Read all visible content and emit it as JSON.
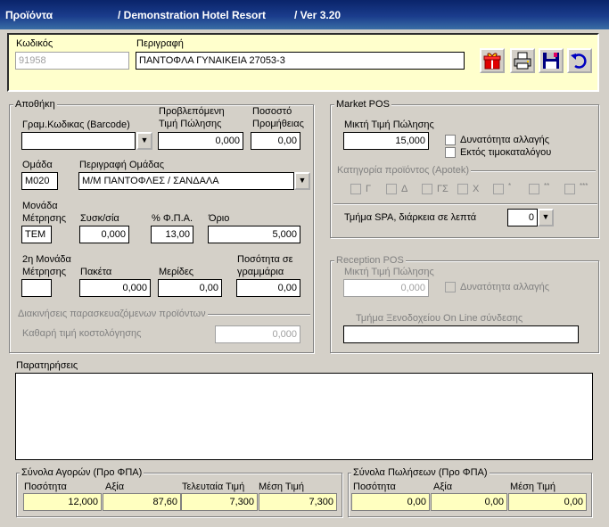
{
  "title": {
    "app": "Προϊόντα",
    "hotel": "/ Demonstration Hotel Resort",
    "version": "/  Ver  3.20"
  },
  "header": {
    "code_label": "Κωδικός",
    "code_value": "91958",
    "desc_label": "Περιγραφή",
    "desc_value": "ΠΑΝΤΟΦΛΑ ΓΥΝΑΙΚΕΙΑ 27053-3"
  },
  "toolbar": {
    "icons": [
      "gift-icon",
      "printer-icon",
      "save-icon",
      "undo-icon"
    ]
  },
  "warehouse": {
    "title": "Αποθήκη",
    "barcode_label": "Γραμ.Κωδικας (Barcode)",
    "barcode_value": "",
    "price_label1": "Προβλεπόμενη",
    "price_label2": "Τιμή Πώλησης",
    "price_value": "0,000",
    "commission_label1": "Ποσοστό",
    "commission_label2": "Προμήθειας",
    "commission_value": "0,00",
    "group_label": "Ομάδα",
    "group_value": "M020",
    "group_desc_label": "Περιγραφή Ομάδας",
    "group_desc_value": "Μ/Μ ΠΑΝΤΟΦΛΕΣ / ΣΑΝΔΑΛΑ",
    "unit_label1": "Μονάδα",
    "unit_label2": "Μέτρησης",
    "unit_value": "TEM",
    "pack_label": "Συσκ/σία",
    "pack_value": "0,000",
    "vat_label": "% Φ.Π.Α.",
    "vat_value": "13,00",
    "limit_label": "Όριο",
    "limit_value": "5,000",
    "unit2_label1": "2η Μονάδα",
    "unit2_label2": "Μέτρησης",
    "unit2_value": "",
    "packets_label": "Πακέτα",
    "packets_value": "0,000",
    "portions_label": "Μερίδες",
    "portions_value": "0,00",
    "grams_label1": "Ποσότητα σε",
    "grams_label2": "γραμμάρια",
    "grams_value": "0,00",
    "prepared_title": "Διακινήσεις παρασκευαζόμενων προϊόντων",
    "net_cost_label": "Καθαρή τιμή κοστολόγησης",
    "net_cost_value": "0,000"
  },
  "market_pos": {
    "title": "Market POS",
    "price_label": "Μικτή Τιμή Πώλησης",
    "price_value": "15,000",
    "change_label": "Δυνατότητα αλλαγής",
    "offlist_label": "Εκτός τιμοκαταλόγου",
    "category_title": "Κατηγορία προϊόντος (Apotek)",
    "categories": [
      "Γ",
      "Δ",
      "ΓΣ",
      "Χ",
      "*",
      "**",
      "***"
    ],
    "spa_label": "Τμήμα SPA, διάρκεια σε λεπτά",
    "spa_value": "0"
  },
  "reception_pos": {
    "title": "Reception POS",
    "price_label": "Μικτή Τιμή Πώλησης",
    "price_value": "0,000",
    "change_label": "Δυνατότητα αλλαγής",
    "dept_label": "Τμήμα Ξενοδοχείου On Line σύνδεσης",
    "dept_value": ""
  },
  "notes": {
    "label": "Παρατηρήσεις",
    "value": ""
  },
  "purchases": {
    "title": "Σύνολα Αγορών (Προ ΦΠΑ)",
    "qty_label": "Ποσότητα",
    "qty_value": "12,000",
    "value_label": "Αξία",
    "value_value": "87,60",
    "last_label": "Τελευταία Τιμή",
    "last_value": "7,300",
    "avg_label": "Μέση Τιμή",
    "avg_value": "7,300"
  },
  "sales": {
    "title": "Σύνολα Πωλήσεων (Προ ΦΠΑ)",
    "qty_label": "Ποσότητα",
    "qty_value": "0,00",
    "value_label": "Αξία",
    "value_value": "0,00",
    "avg_label": "Μέση Τιμή",
    "avg_value": "0,00"
  }
}
